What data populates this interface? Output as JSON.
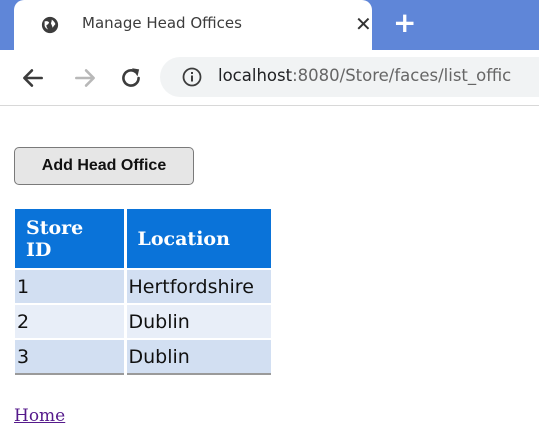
{
  "browser": {
    "tab_title": "Manage Head Offices",
    "close_glyph": "✕",
    "new_tab_glyph": "+",
    "url_host": "localhost",
    "url_path": ":8080/Store/faces/list_offic"
  },
  "page": {
    "add_button_label": "Add Head Office",
    "table": {
      "headers": [
        "Store ID",
        "Location"
      ],
      "rows": [
        {
          "id": "1",
          "location": "Hertfordshire"
        },
        {
          "id": "2",
          "location": "Dublin"
        },
        {
          "id": "3",
          "location": "Dublin"
        }
      ]
    },
    "home_link": "Home"
  },
  "colors": {
    "tab_strip": "#5f86d8",
    "table_header": "#0a73d9",
    "row_odd": "#d2dff2",
    "row_even": "#e8eef8",
    "visited_link": "#551a8b"
  },
  "icons": [
    "globe-icon",
    "close-icon",
    "new-tab-icon",
    "back-arrow-icon",
    "forward-arrow-icon",
    "reload-icon",
    "info-icon"
  ]
}
